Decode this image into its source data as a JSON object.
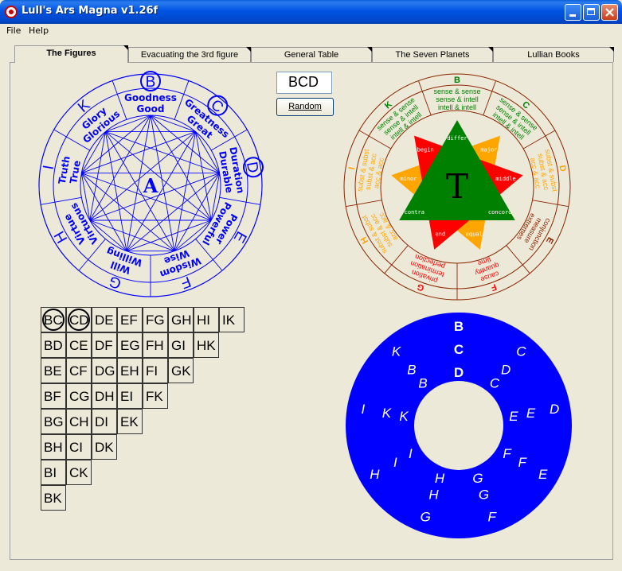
{
  "window": {
    "title": "Lull's Ars Magna v1.26f"
  },
  "menu": [
    "File",
    "Help"
  ],
  "tabs": [
    {
      "label": "The Figures",
      "active": true
    },
    {
      "label": "Evacuating the 3rd figure",
      "active": false
    },
    {
      "label": "General Table",
      "active": false
    },
    {
      "label": "The Seven Planets",
      "active": false
    },
    {
      "label": "Lullian Books",
      "active": false
    }
  ],
  "combo": {
    "value": "BCD"
  },
  "random_button": {
    "label": "Random"
  },
  "figure_a": {
    "center": "A",
    "letters": [
      "B",
      "C",
      "D",
      "E",
      "F",
      "G",
      "H",
      "I",
      "K"
    ],
    "circled": [
      "B",
      "C",
      "D"
    ],
    "noun_labels": [
      "Goodness",
      "Greatness",
      "Duration",
      "Power",
      "Wisdom",
      "Will",
      "Virtue",
      "Truth",
      "Glory"
    ],
    "adj_labels": [
      "Good",
      "Great",
      "Durable",
      "Powerful",
      "Wise",
      "Willing",
      "Virtuous",
      "True",
      "Glorious"
    ],
    "color": "#0000ff"
  },
  "figure_t": {
    "center": "T",
    "ring_letters": [
      "B",
      "C",
      "D",
      "E",
      "F",
      "G",
      "H",
      "I",
      "K"
    ],
    "triangle_green": [
      "differ",
      "concord",
      "contra"
    ],
    "triangle_red": [
      "begin",
      "middle",
      "end"
    ],
    "triangle_orange": [
      "major",
      "equal",
      "minor"
    ],
    "segments": [
      [
        "sense & sense",
        "sense & intell",
        "intell & intell"
      ],
      [
        "sense & sense",
        "sense & intell",
        "intell & intell"
      ],
      [
        "sense & sense",
        "sense & intell",
        "intell & intell"
      ],
      [
        "subst & subst",
        "subst & acc",
        "acc & acc"
      ],
      [
        "subst & subst",
        "subst & acc",
        "acc & acc"
      ],
      [
        "subst & subst",
        "subst & acc",
        "acc & acc"
      ],
      [
        "conjunction",
        "measure",
        "extremes"
      ],
      [
        "privation",
        "termination",
        "perfection"
      ],
      [
        "cause",
        "quantity",
        "time"
      ]
    ],
    "colors": {
      "green": "#008000",
      "red": "#ff0000",
      "orange": "#ffa500",
      "brown": "#8b2500"
    }
  },
  "pair_table": [
    [
      "BC",
      "CD",
      "DE",
      "EF",
      "FG",
      "GH",
      "HI",
      "IK"
    ],
    [
      "BD",
      "CE",
      "DF",
      "EG",
      "FH",
      "GI",
      "HK"
    ],
    [
      "BE",
      "CF",
      "DG",
      "EH",
      "FI",
      "GK"
    ],
    [
      "BF",
      "CG",
      "DH",
      "EI",
      "FK"
    ],
    [
      "BG",
      "CH",
      "DI",
      "EK"
    ],
    [
      "BH",
      "CI",
      "DK"
    ],
    [
      "BI",
      "CK"
    ],
    [
      "BK"
    ]
  ],
  "selected_pairs": [
    "BC",
    "CD"
  ],
  "wheel": {
    "color": "#0000ff",
    "top_letters": [
      "B",
      "C",
      "D"
    ],
    "outer": [
      "C",
      "D",
      "E",
      "F",
      "G",
      "H",
      "I",
      "K"
    ],
    "middle": [
      "D",
      "E",
      "F",
      "G",
      "H",
      "I",
      "K",
      "B"
    ],
    "inner": [
      "C",
      "E",
      "F",
      "G",
      "H",
      "I",
      "K",
      "B"
    ]
  }
}
